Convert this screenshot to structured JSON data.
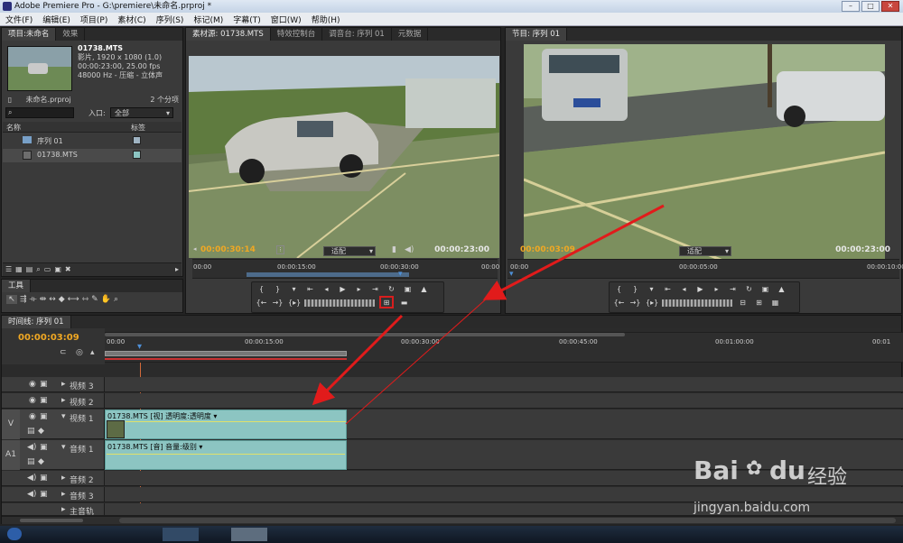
{
  "window": {
    "title": "Adobe Premiere Pro - G:\\premiere\\未命名.prproj *"
  },
  "menu": [
    "文件(F)",
    "编辑(E)",
    "项目(P)",
    "素材(C)",
    "序列(S)",
    "标记(M)",
    "字幕(T)",
    "窗口(W)",
    "帮助(H)"
  ],
  "project": {
    "tabs": [
      "项目:未命名",
      "效果"
    ],
    "clip_name": "01738.MTS",
    "info": [
      "影片, 1920 x 1080 (1.0)",
      "00:00:23:00, 25.00 fps",
      "48000 Hz - 压缩 - 立体声"
    ],
    "file": "未命名.prproj",
    "count": "2 个分项",
    "entry_label": "入口:",
    "entry_value": "全部",
    "col_name": "名称",
    "col_label": "标签",
    "items": [
      {
        "name": "序列 01",
        "color": "#9fb3c2"
      },
      {
        "name": "01738.MTS",
        "color": "#8cc5c2"
      }
    ]
  },
  "source": {
    "tabs": [
      "素材源: 01738.MTS",
      "特效控制台",
      "调音台: 序列 01",
      "元数据"
    ],
    "timecode": "00:00:30:14",
    "fit": "适配",
    "duration": "00:00:23:00",
    "ruler": [
      "00:00",
      "00:00:15:00",
      "00:00:30:00",
      "00:00"
    ]
  },
  "program": {
    "tabs": [
      "节目: 序列 01"
    ],
    "timecode": "00:00:03:09",
    "fit": "适配",
    "duration": "00:00:23:00",
    "ruler": [
      "00:00",
      "00:00:05:00",
      "00:00:10:00"
    ]
  },
  "tools": {
    "title": "工具"
  },
  "timeline": {
    "tab": "时间线: 序列 01",
    "timecode": "00:00:03:09",
    "ruler": [
      "00:00",
      "00:00:15:00",
      "00:00:30:00",
      "00:00:45:00",
      "00:01:00:00",
      "00:01"
    ],
    "tracks": [
      {
        "name": "视频 3",
        "type": "video"
      },
      {
        "name": "视频 2",
        "type": "video"
      },
      {
        "name": "视频 1",
        "type": "video",
        "target": "V",
        "clip": "01738.MTS [视] 透明度:透明度 ▾"
      },
      {
        "name": "音频 1",
        "type": "audio",
        "target": "A1",
        "clip": "01738.MTS [音] 音量:级别 ▾"
      },
      {
        "name": "音频 2",
        "type": "audio"
      },
      {
        "name": "音频 3",
        "type": "audio"
      },
      {
        "name": "主音轨",
        "type": "master"
      }
    ]
  },
  "watermark": {
    "brand": "Bai",
    "brand2": "du",
    "cn": "经验",
    "url": "jingyan.baidu.com"
  }
}
